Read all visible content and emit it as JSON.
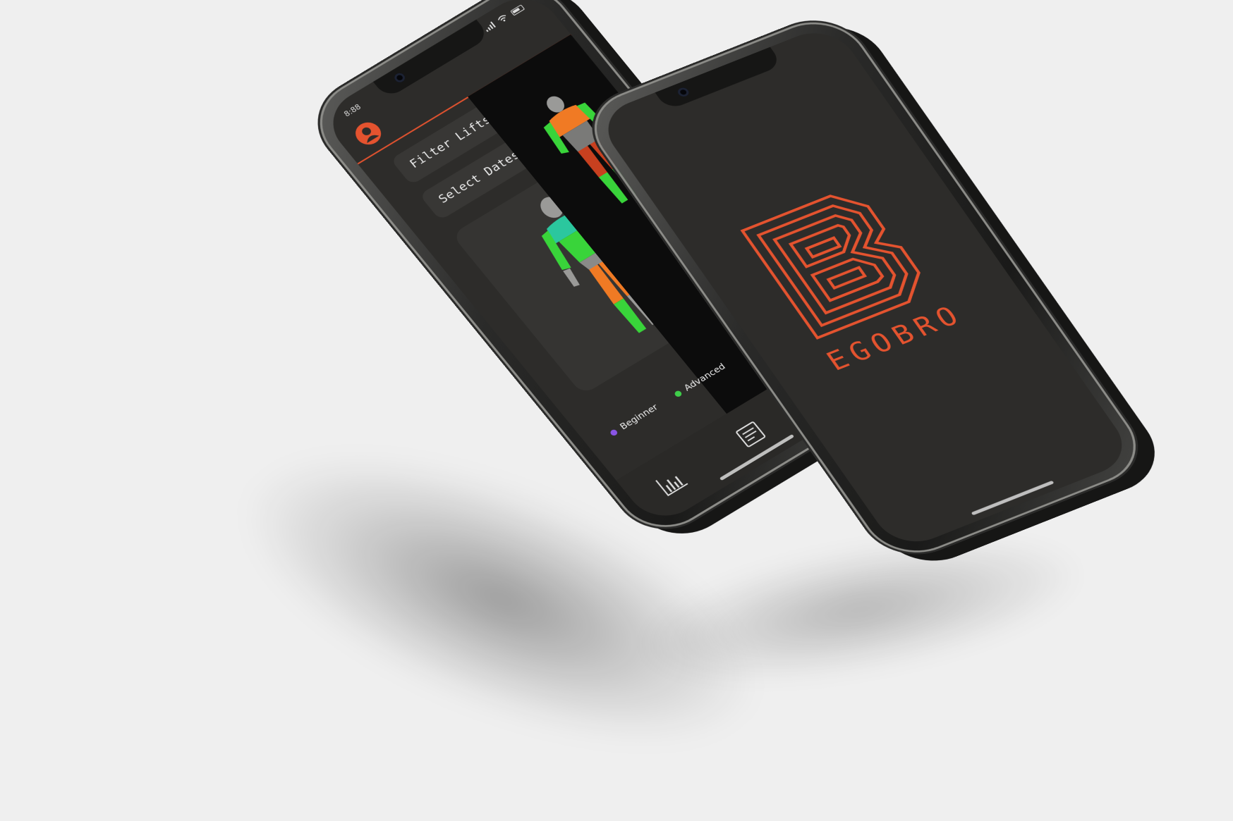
{
  "colors": {
    "accent": "#e4532f",
    "screen_bg": "#2d2c2a",
    "card_bg": "#383735",
    "beginner": "#8a55e6",
    "advanced": "#3fcf4a",
    "muscle_teal": "#2bc79e",
    "muscle_green": "#39d43a",
    "muscle_orange": "#f07a24",
    "muscle_red": "#c8401f"
  },
  "app": {
    "status_time": "8:88",
    "filter_label": "Filter Lifts",
    "dates_label": "Select Dates",
    "legend": [
      {
        "label": "Beginner",
        "color": "#8a55e6"
      },
      {
        "label": "Advanced",
        "color": "#3fcf4a"
      }
    ],
    "icons": {
      "avatar": "user-icon",
      "chart": "bar-chart-icon",
      "list": "list-icon"
    }
  },
  "splash": {
    "brand": "EGOBRO",
    "logo_icon": "b-maze-logo-icon"
  }
}
